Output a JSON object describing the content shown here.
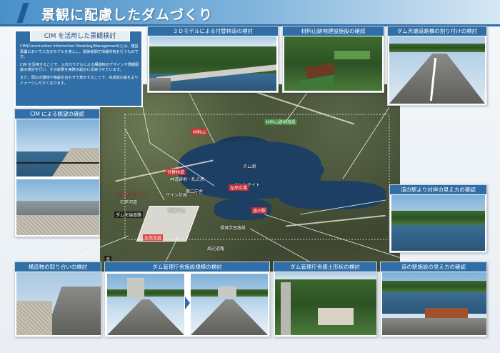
{
  "header": {
    "title": "景観に配慮したダムづくり"
  },
  "intro": {
    "title": "CIM を活用した景観検討",
    "paragraphs": [
      "CIM(Construction Information Modeling/Management)とは、建設事業において三次元モデルを導入し、関係者間で情報共有を行うものです。",
      "CIM を活用することで、三次元モデルによる構造物のデザインや景観配慮の検討を行い、その結果を実際の設計に反映させています。",
      "また、周辺の建物や施設を合わせて表示することで、完成後の姿をよりイメージしやすくなります。"
    ]
  },
  "panels": {
    "model_3d": "３Ｄモデルによる付替林道の検討",
    "material_site": "材料山跡地建設施設の確認",
    "dam_road": "ダム天端道路橋の割り付けの検討",
    "cim_view": "CIM による眺望の確認",
    "station_view": "道の駅より対岸の見え方の確認",
    "structure_match": "構造物の取り合いの検討",
    "office_scale": "ダム管理庁舎施設規模の検討",
    "office_embank": "ダム管理庁舎盛土形状の検討",
    "station_facility": "道の駅施設の見え方の確認"
  },
  "map": {
    "labels": {
      "material_mountain": "材料山",
      "material_site": "材料山跡地施設",
      "forest_road": "付替林道",
      "road_label_2": "林道跡地・乱占用",
      "site_1": "テントサイト",
      "bicycle_road": "サイクルロード",
      "right_bank": "右岸河道",
      "dam_crest": "ダム天端道路",
      "sign": "サイン計画",
      "road_2": "第二庁舎",
      "left_area": "左岸広場",
      "office": "管理庁舎",
      "station": "道の駅",
      "dam_lake": "ダム湖",
      "north": "北",
      "spot_a": "左岸河道",
      "spot_b": "環境学習施設",
      "spot_c": "周辺道路"
    }
  }
}
